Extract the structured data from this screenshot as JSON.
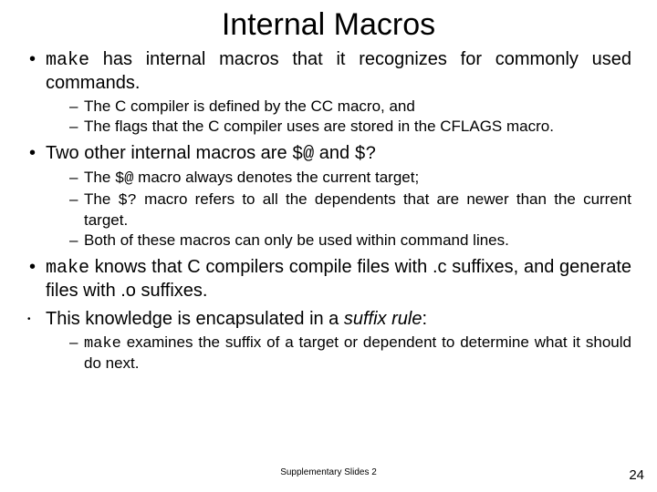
{
  "title": "Internal Macros",
  "bullets": {
    "b1_a": "make",
    "b1_b": " has internal macros that it recognizes for commonly used commands.",
    "b1s1": "The C compiler is defined by the CC macro, and",
    "b1s2": "The flags that the C compiler uses are stored in the CFLAGS macro.",
    "b2_a": "Two other internal macros are ",
    "b2_b": "$@",
    "b2_c": " and ",
    "b2_d": "$?",
    "b2s1_a": "The ",
    "b2s1_b": "$@",
    "b2s1_c": " macro always denotes the current target;",
    "b2s2_a": "The ",
    "b2s2_b": "$?",
    "b2s2_c": " macro refers to all the dependents that are newer than the current target.",
    "b2s3": "Both of these macros can only be used within command lines.",
    "b3_a": "make",
    "b3_b": " knows that C compilers compile files with .c suffixes, and generate files with .o suffixes.",
    "b4_a": "This knowledge is encapsulated in a ",
    "b4_b": "suffix rule",
    "b4_c": ":",
    "b4s1_a": "make",
    "b4s1_b": " examines the suffix of a target or dependent to determine what it should do next."
  },
  "footer": "Supplementary Slides 2",
  "page": "24"
}
